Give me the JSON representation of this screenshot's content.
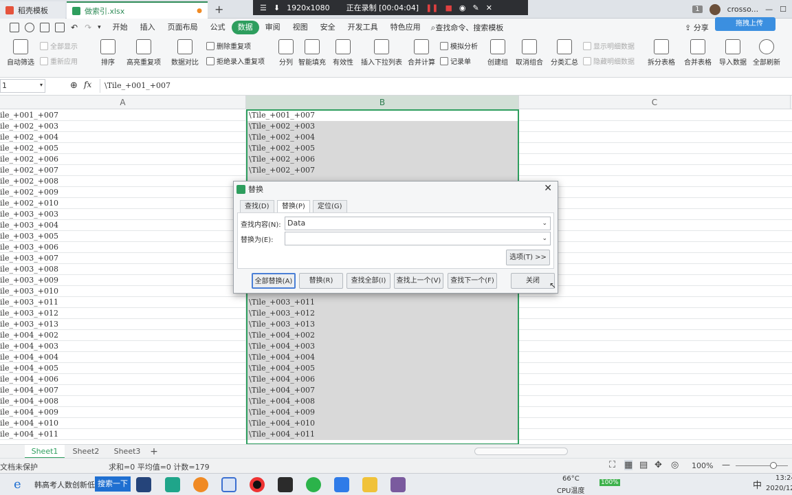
{
  "titlebar": {
    "tab1": "稻壳模板",
    "tab2": "做索引.xlsx",
    "rec_resolution": "1920x1080",
    "rec_status": "正在录制 [00:04:04]",
    "badge": "1",
    "user": "crosso..."
  },
  "menubar": {
    "items": [
      "开始",
      "插入",
      "页面布局",
      "公式",
      "数据",
      "审阅",
      "视图",
      "安全",
      "开发工具",
      "特色应用"
    ],
    "active": "数据",
    "search": "查找命令、搜索模板",
    "share": "分享",
    "upload": "拖拽上传"
  },
  "ribbon": {
    "auto_filter": "自动筛选",
    "show_all": "全部显示",
    "reapply": "重新应用",
    "sort": "排序",
    "highlight_dup": "高亮重复项",
    "data_compare": "数据对比",
    "delete_dup": "删除重复项",
    "reject_dup": "拒绝录入重复项",
    "split": "分列",
    "smart_fill": "智能填充",
    "validity": "有效性",
    "insert_dropdown": "插入下拉列表",
    "consolidate": "合并计算",
    "simulate": "模拟分析",
    "record": "记录单",
    "create_group": "创建组",
    "ungroup": "取消组合",
    "subtotal": "分类汇总",
    "show_detail": "显示明细数据",
    "hide_detail": "隐藏明细数据",
    "split_table": "拆分表格",
    "merge_table": "合并表格",
    "import_data": "导入数据",
    "refresh_all": "全部刷新"
  },
  "formula": {
    "namebox": "1",
    "fx": "fx",
    "value": "\\Tile_+001_+007"
  },
  "columns": [
    "A",
    "B",
    "C"
  ],
  "rows": [
    [
      "ile_+001_+007",
      "\\Tile_+001_+007"
    ],
    [
      "ile_+002_+003",
      "\\Tile_+002_+003"
    ],
    [
      "ile_+002_+004",
      "\\Tile_+002_+004"
    ],
    [
      "ile_+002_+005",
      "\\Tile_+002_+005"
    ],
    [
      "ile_+002_+006",
      "\\Tile_+002_+006"
    ],
    [
      "ile_+002_+007",
      "\\Tile_+002_+007"
    ],
    [
      "ile_+002_+008",
      ""
    ],
    [
      "ile_+002_+009",
      ""
    ],
    [
      "ile_+002_+010",
      ""
    ],
    [
      "ile_+003_+003",
      ""
    ],
    [
      "ile_+003_+004",
      ""
    ],
    [
      "ile_+003_+005",
      ""
    ],
    [
      "ile_+003_+006",
      ""
    ],
    [
      "ile_+003_+007",
      ""
    ],
    [
      "ile_+003_+008",
      ""
    ],
    [
      "ile_+003_+009",
      ""
    ],
    [
      "ile_+003_+010",
      ""
    ],
    [
      "ile_+003_+011",
      "\\Tile_+003_+011"
    ],
    [
      "ile_+003_+012",
      "\\Tile_+003_+012"
    ],
    [
      "ile_+003_+013",
      "\\Tile_+003_+013"
    ],
    [
      "ile_+004_+002",
      "\\Tile_+004_+002"
    ],
    [
      "ile_+004_+003",
      "\\Tile_+004_+003"
    ],
    [
      "ile_+004_+004",
      "\\Tile_+004_+004"
    ],
    [
      "ile_+004_+005",
      "\\Tile_+004_+005"
    ],
    [
      "ile_+004_+006",
      "\\Tile_+004_+006"
    ],
    [
      "ile_+004_+007",
      "\\Tile_+004_+007"
    ],
    [
      "ile_+004_+008",
      "\\Tile_+004_+008"
    ],
    [
      "ile_+004_+009",
      "\\Tile_+004_+009"
    ],
    [
      "ile_+004_+010",
      "\\Tile_+004_+010"
    ],
    [
      "ile_+004_+011",
      "\\Tile_+004_+011"
    ]
  ],
  "sheets": [
    "Sheet1",
    "Sheet2",
    "Sheet3"
  ],
  "status": {
    "protect": "文档未保护",
    "summary": "求和=0  平均值=0  计数=179",
    "zoom": "100%"
  },
  "taskbar": {
    "search_text": "韩高考人数创新低",
    "search_btn": "搜索一下",
    "temp": "66°C",
    "temp_label": "CPU温度",
    "battery": "100%",
    "ime": "中",
    "time": "13:24",
    "date": "2020/12"
  },
  "dialog": {
    "title": "替换",
    "tabs": [
      "查找(D)",
      "替换(P)",
      "定位(G)"
    ],
    "find_label": "查找内容(N):",
    "find_value": "Data",
    "replace_label": "替换为(E):",
    "replace_value": "",
    "options": "选项(T) >>",
    "replace_all": "全部替换(A)",
    "replace": "替换(R)",
    "find_all": "查找全部(I)",
    "find_prev": "查找上一个(V)",
    "find_next": "查找下一个(F)",
    "close": "关闭"
  },
  "colors": {
    "accent": "#2e9e5e",
    "selection": "#d9d9d9"
  }
}
